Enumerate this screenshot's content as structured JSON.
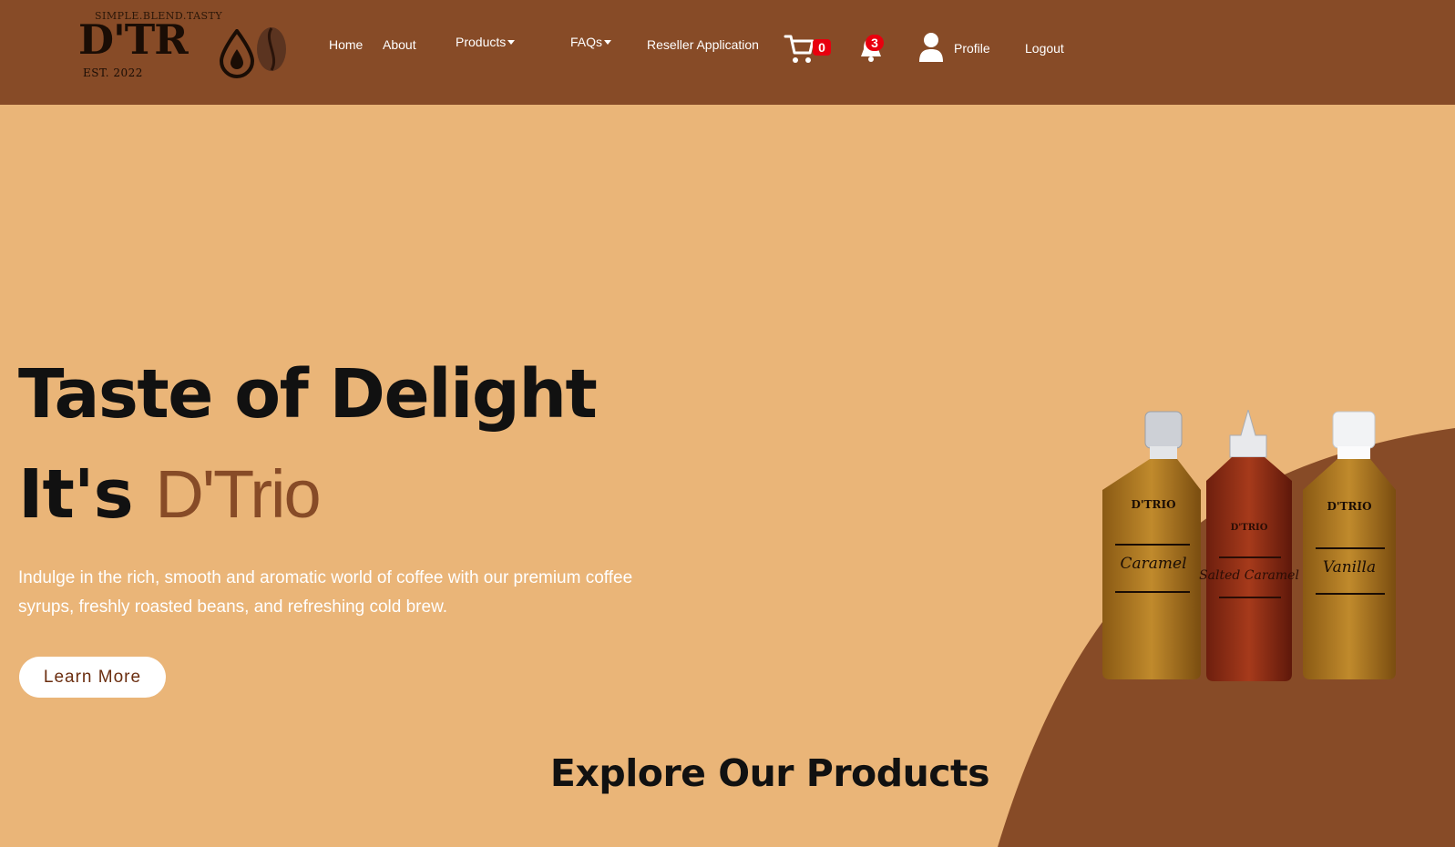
{
  "logo": {
    "tagline": "SIMPLE.BLEND.TASTY",
    "wordmark": "D'TR",
    "est": "EST. 2022"
  },
  "nav": {
    "home": "Home",
    "about": "About",
    "products": "Products",
    "faqs": "FAQs",
    "reseller": "Reseller Application",
    "cart_count": "0",
    "notification_count": "3",
    "profile": "Profile",
    "logout": "Logout"
  },
  "hero": {
    "title": "Taste of Delight",
    "subtitle_prefix": "It's ",
    "brand_name": "D'Trio",
    "description": "Indulge in the rich, smooth and aromatic world of coffee with our premium coffee syrups, freshly roasted beans, and refreshing cold brew.",
    "cta": "Learn More"
  },
  "products_heading": "Explore Our Products",
  "bottles": [
    {
      "label": "Caramel",
      "brand": "D'TRIO"
    },
    {
      "label": "Salted Caramel",
      "brand": "D'TRIO"
    },
    {
      "label": "Vanilla",
      "brand": "D'TRIO"
    }
  ],
  "colors": {
    "navbar": "#874B27",
    "background": "#EAB578",
    "brand_accent": "#874B27",
    "badge": "#E8000E"
  }
}
